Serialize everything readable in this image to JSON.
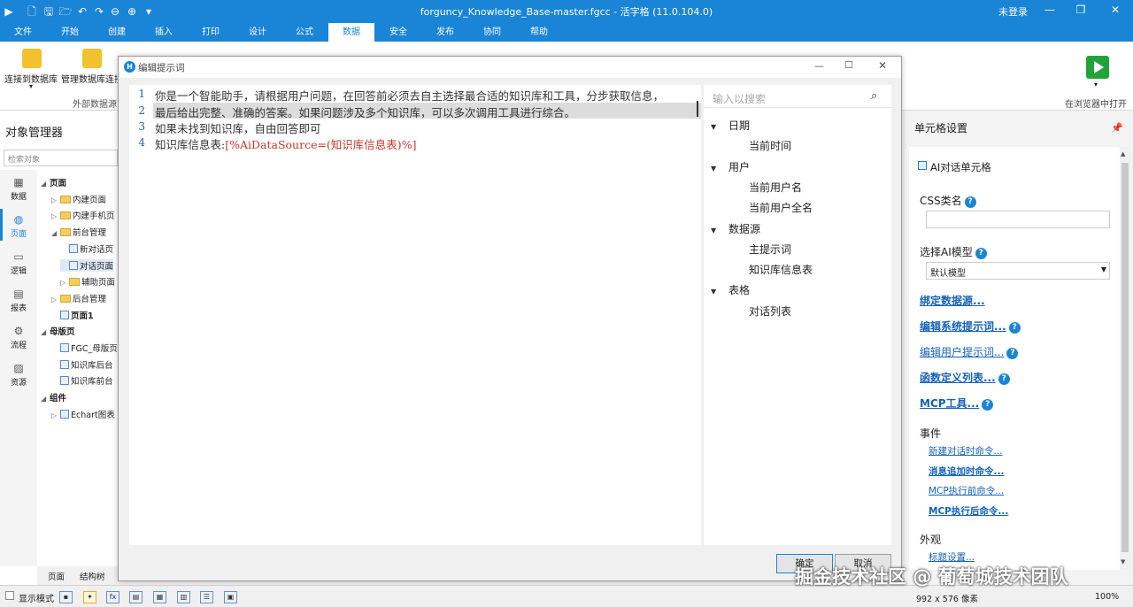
{
  "app": {
    "title": "forguncy_Knowledge_Base-master.fgcc - 活字格 (11.0.104.0)",
    "login": "未登录"
  },
  "menu": [
    "文件",
    "开始",
    "创建",
    "插入",
    "打印",
    "设计",
    "公式",
    "数据",
    "安全",
    "发布",
    "协同",
    "帮助"
  ],
  "ribbon": {
    "connect_db": "连接到数据库",
    "manage_db": "管理数据库连接",
    "group_external": "外部数据源",
    "open_browser": "在浏览器中打开"
  },
  "obj_manager": {
    "title": "对象管理器",
    "search_placeholder": "检索对象",
    "side": [
      "数据",
      "页面",
      "逻辑",
      "报表",
      "流程",
      "资源"
    ],
    "tree": [
      "页面",
      "内建页面",
      "内建手机页",
      "前台管理",
      "新对话页",
      "对话页面",
      "辅助页面",
      "后台管理",
      "页面1",
      "母版页",
      "FGC_母版页",
      "知识库后台",
      "知识库前台",
      "组件",
      "Echart图表"
    ],
    "bottom_tabs": [
      "页面",
      "结构树"
    ]
  },
  "dialog": {
    "title": "编辑提示词",
    "lines": [
      {
        "num": "1",
        "text": "你是一个智能助手，请根据用户问题，在回答前必须去自主选择最合适的知识库和工具，分步获取信息，"
      },
      {
        "num": "2",
        "text": "最后给出完整、准确的答案。如果问题涉及多个知识库，可以多次调用工具进行综合。"
      },
      {
        "num": "3",
        "text": "如果未找到知识库，自由回答即可"
      },
      {
        "num": "4",
        "text_prefix": "知识库信息表:",
        "text_var": "[%AiDataSource=(知识库信息表)%]"
      }
    ],
    "search_placeholder": "输入以搜索",
    "var_tree": [
      {
        "label": "日期",
        "children": [
          "当前时间"
        ]
      },
      {
        "label": "用户",
        "children": [
          "当前用户名",
          "当前用户全名"
        ]
      },
      {
        "label": "数据源",
        "children": [
          "主提示词",
          "知识库信息表"
        ]
      },
      {
        "label": "表格",
        "children": [
          "对话列表"
        ]
      }
    ],
    "ok": "确定",
    "cancel": "取消"
  },
  "cell_settings": {
    "title": "单元格设置",
    "cell_type": "AI对话单元格",
    "css_label": "CSS类名",
    "css_value": "",
    "model_label": "选择AI模型",
    "model_value": "默认模型",
    "links": [
      "绑定数据源...",
      "编辑系统提示词...",
      "编辑用户提示词...",
      "函数定义列表...",
      "MCP工具..."
    ],
    "events_label": "事件",
    "events": [
      "新建对话时命令...",
      "消息追加时命令...",
      "MCP执行前命令...",
      "MCP执行后命令..."
    ],
    "appearance_label": "外观",
    "appearance_link": "标题设置..."
  },
  "status": {
    "display_mode": "显示模式",
    "size": "992 x 576 像素",
    "zoom": "100%"
  },
  "watermark": "掘金技术社区 @ 葡萄城技术团队",
  "colors": {
    "accent": "#1a84d6",
    "link": "#1562b8",
    "code_var": "#c0392b"
  }
}
